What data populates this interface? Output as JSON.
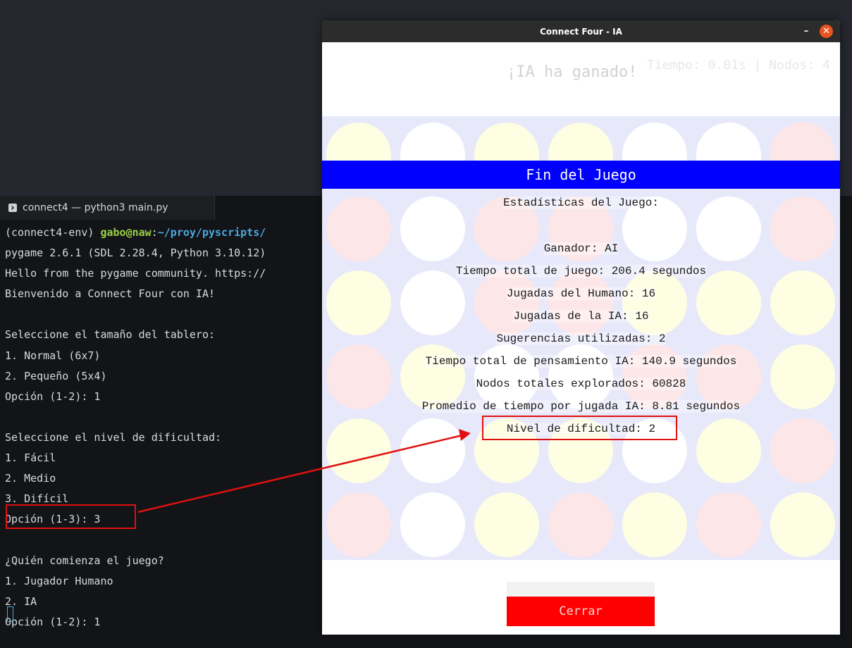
{
  "terminal": {
    "tab_label": "connect4 — python3 main.py",
    "prompt_env": "(connect4-env) ",
    "prompt_user": "gabo@naw",
    "prompt_sep": ":",
    "prompt_path": "~/proy/pyscripts/",
    "lines": [
      "pygame 2.6.1 (SDL 2.28.4, Python 3.10.12)",
      "Hello from the pygame community. https://",
      "Bienvenido a Connect Four con IA!",
      "",
      "Seleccione el tamaño del tablero:",
      "1. Normal (6x7)",
      "2. Pequeño (5x4)",
      "Opción (1-2): 1",
      "",
      "Seleccione el nivel de dificultad:",
      "1. Fácil",
      "2. Medio",
      "3. Difícil",
      "Opción (1-3): 3",
      "",
      "¿Quién comienza el juego?",
      "1. Jugador Humano",
      "2. IA",
      "Opción (1-2): 1"
    ]
  },
  "game_window": {
    "title": "Connect Four - IA",
    "minimize_symbol": "–",
    "close_symbol": "✕",
    "winner_text": "¡IA ha ganado!",
    "ai_stats_text": "Tiempo: 0.01s | Nodos: 4",
    "board": {
      "rows": 6,
      "cols": 7,
      "cells": [
        [
          "yellow",
          "empty",
          "yellow",
          "yellow",
          "empty",
          "empty",
          "red"
        ],
        [
          "red",
          "empty",
          "red",
          "red",
          "empty",
          "empty",
          "red"
        ],
        [
          "yellow",
          "empty",
          "red",
          "red",
          "yellow",
          "yellow",
          "yellow"
        ],
        [
          "red",
          "yellow",
          "empty",
          "empty",
          "red",
          "red",
          "yellow"
        ],
        [
          "yellow",
          "empty",
          "yellow",
          "yellow",
          "empty",
          "yellow",
          "red"
        ],
        [
          "red",
          "empty",
          "yellow",
          "red",
          "yellow",
          "red",
          "yellow"
        ]
      ]
    },
    "overlay": {
      "title": "Fin del Juego",
      "heading": "Estadísticas del Juego:",
      "stats": [
        "Ganador: AI",
        "Tiempo total de juego: 206.4 segundos",
        "Jugadas del Humano: 16",
        "Jugadas de la IA: 16",
        "Sugerencias utilizadas: 2",
        "Tiempo total de pensamiento IA: 140.9 segundos",
        "Nodos totales explorados: 60828",
        "Promedio de tiempo por jugada IA: 8.81 segundos",
        "Nivel de dificultad: 2"
      ]
    },
    "close_button_label": "Cerrar"
  },
  "colors": {
    "banner": "#0000ff",
    "close_button": "#ff0000",
    "annotation": "#e01010",
    "yellow_piece": "#fefee3",
    "red_piece": "#fde6e8",
    "board_bg": "#e8e8fb"
  }
}
